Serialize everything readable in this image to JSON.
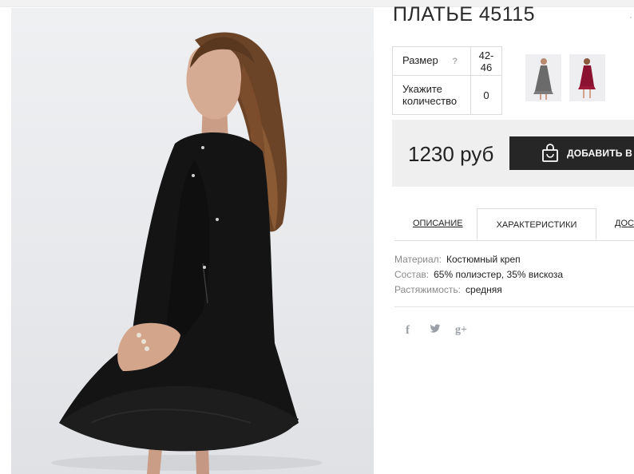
{
  "product": {
    "title": "ПЛАТЬЕ 45115",
    "size_label": "Размер",
    "size_help": "?",
    "size_value": "42-46",
    "qty_label": "Укажите количество",
    "qty_value": "0",
    "price": "1230 руб",
    "add_to_cart": "ДОБАВИТЬ В ЗА"
  },
  "thumbnails": [
    {
      "name": "thumbnail-grey-dress"
    },
    {
      "name": "thumbnail-red-dress"
    }
  ],
  "tabs": [
    {
      "label": "ОПИСАНИЕ",
      "active": false
    },
    {
      "label": "ХАРАКТЕРИСТИКИ",
      "active": true
    },
    {
      "label": "ДОСТ",
      "active": false
    }
  ],
  "specs": [
    {
      "key": "Материал:",
      "value": "Костюмный креп"
    },
    {
      "key": "Состав:",
      "value": "65% полиэстер, 35% вискоза"
    },
    {
      "key": "Растяжимость:",
      "value": "средняя"
    }
  ],
  "social": {
    "facebook": "f",
    "twitter": "twitter-icon",
    "googleplus": "g+"
  },
  "colors": {
    "button_bg": "#262626",
    "price_bg": "#efefef",
    "dress": "#141414",
    "hair": "#6b4428"
  }
}
